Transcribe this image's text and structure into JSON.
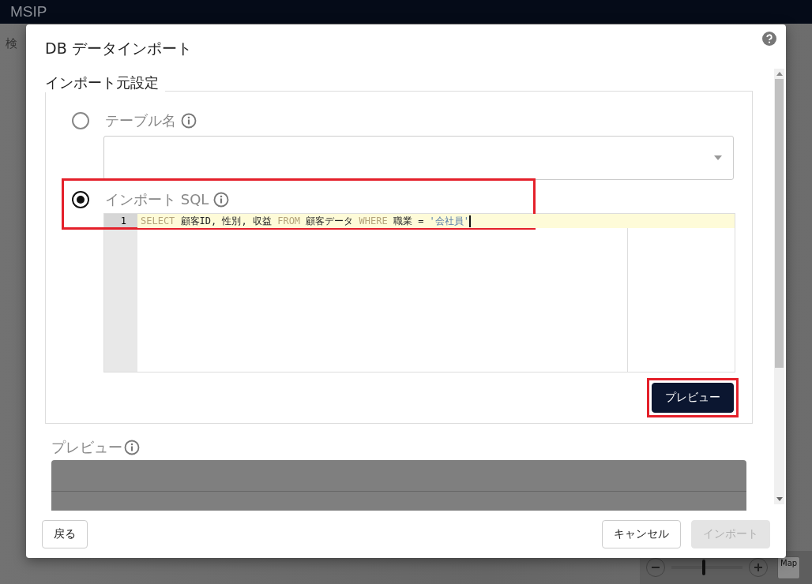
{
  "app": {
    "title": "MSIP",
    "search_label": "検"
  },
  "map_controls": {
    "label": "Map",
    "zoom": {
      "level": 0.45
    }
  },
  "dialog": {
    "title": "DB データインポート",
    "source_section": {
      "legend": "インポート元設定",
      "options": [
        {
          "kind": "table",
          "label": "テーブル名",
          "selected": false,
          "highlighted": false
        },
        {
          "kind": "sql",
          "label": "インポート SQL",
          "selected": true,
          "highlighted": true
        }
      ],
      "sql_lines": [
        {
          "number": "1",
          "tokens": [
            {
              "kind": "keyword",
              "text": "SELECT"
            },
            {
              "kind": "plain",
              "text": "顧客ID, 性別, 収益"
            },
            {
              "kind": "keyword",
              "text": "FROM"
            },
            {
              "kind": "plain",
              "text": "顧客データ"
            },
            {
              "kind": "keyword",
              "text": "WHERE"
            },
            {
              "kind": "plain",
              "text": "職業 ="
            },
            {
              "kind": "string",
              "text": "'会社員'"
            }
          ]
        }
      ],
      "preview_button": {
        "label": "プレビュー",
        "highlighted": true
      }
    },
    "preview_section": {
      "label": "プレビュー"
    },
    "buttons": [
      {
        "kind": "back",
        "label": "戻る",
        "disabled": false
      },
      {
        "kind": "cancel",
        "label": "キャンセル",
        "disabled": false
      },
      {
        "kind": "import",
        "label": "インポート",
        "disabled": true
      }
    ]
  }
}
